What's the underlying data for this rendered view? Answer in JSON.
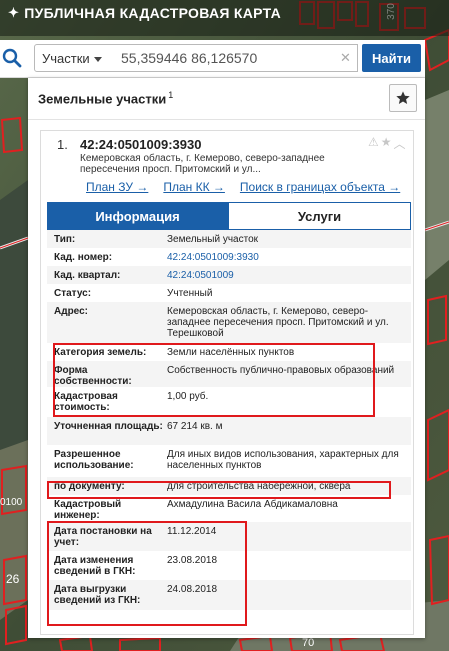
{
  "app": {
    "title": "ПУБЛИЧНАЯ КАДАСТРОВАЯ КАРТА"
  },
  "search": {
    "type_label": "Участки",
    "query": "55,359446 86,126570",
    "clear_label": "✕",
    "button_label": "Найти"
  },
  "panel": {
    "title": "Земельные участки",
    "title_count": "1"
  },
  "card": {
    "index": "1.",
    "cad_number": "42:24:0501009:3930",
    "address_short": "Кемеровская область, г. Кемерово, северо-западнее пересечения просп. Притомский и ул...",
    "links": [
      "План ЗУ →",
      "План КК →",
      "Поиск в границах объекта →"
    ],
    "tabs": [
      "Информация",
      "Услуги"
    ]
  },
  "info_rows": [
    {
      "key": "Тип:",
      "value": "Земельный участок"
    },
    {
      "key": "Кад. номер:",
      "value": "42:24:0501009:3930"
    },
    {
      "key": "Кад. квартал:",
      "value": "42:24:0501009"
    },
    {
      "key": "Статус:",
      "value": "Учтенный"
    },
    {
      "key": "Адрес:",
      "value": "Кемеровская область, г. Кемерово, северо-западнее пересечения просп. Притомский и ул. Терешковой"
    },
    {
      "key": "Категория земель:",
      "value": "Земли населённых пунктов"
    },
    {
      "key": "Форма собственности:",
      "value": "Собственность публично-правовых образований"
    },
    {
      "key": "Кадастровая стоимость:",
      "value": "1,00 руб."
    },
    {
      "key": "Уточненная площадь:",
      "value": "67 214 кв. м"
    },
    {
      "key": "Разрешенное использование:",
      "value": "Для иных видов использования, характерных для населенных пунктов"
    },
    {
      "key": "по документу:",
      "value": "для строительства набережной, сквера"
    },
    {
      "key": "Кадастровый инженер:",
      "value": "Ахмадулина Васила Абдикамаловна"
    },
    {
      "key": "Дата постановки на учет:",
      "value": "11.12.2014"
    },
    {
      "key": "Дата изменения сведений в ГКН:",
      "value": "23.08.2018"
    },
    {
      "key": "Дата выгрузки сведений из ГКН:",
      "value": "24.08.2018"
    }
  ],
  "map_labels": [
    "370",
    "0100",
    "26",
    "70"
  ],
  "colors": {
    "accent": "#1a5fa8",
    "highlight": "#e0191c",
    "parcel_outline": "#e02020"
  },
  "icons": [
    "search-icon",
    "star-icon",
    "warning-icon",
    "chevron-up-icon",
    "caret-down-icon",
    "clear-icon"
  ]
}
